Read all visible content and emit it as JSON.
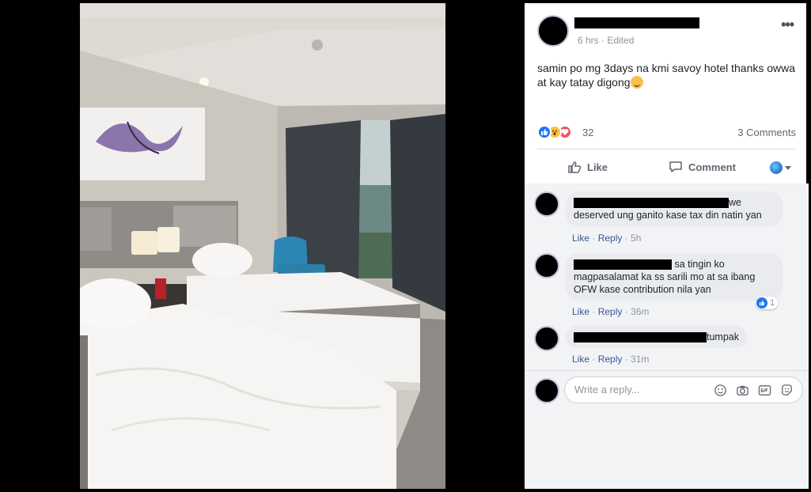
{
  "post": {
    "time": "6 hrs",
    "edited": "Edited",
    "more": "•••",
    "text": "samin po mg 3days na kmi savoy hotel thanks owwa at kay tatay digong",
    "reaction_count": "32",
    "comments_count": "3 Comments"
  },
  "actions": {
    "like": "Like",
    "comment": "Comment"
  },
  "comments": [
    {
      "text_line1_suffix": "we",
      "text_rest": "deserved ung ganito kase tax din natin yan",
      "like": "Like",
      "reply": "Reply",
      "time": "5h"
    },
    {
      "text_line1_suffix": "sa tingin ko",
      "text_rest": "magpasalamat ka ss sarili mo at sa ibang OFW kase contribution nila yan",
      "like": "Like",
      "reply": "Reply",
      "time": "36m",
      "likes": "1"
    },
    {
      "text_line1_suffix": "tumpak",
      "like": "Like",
      "reply": "Reply",
      "time": "31m"
    }
  ],
  "reply_box": {
    "placeholder": "Write a reply..."
  },
  "colors": {
    "accent": "#385898",
    "like_blue": "#1877f2",
    "love_red": "#f25268",
    "wow_yellow": "#f7c14a"
  }
}
